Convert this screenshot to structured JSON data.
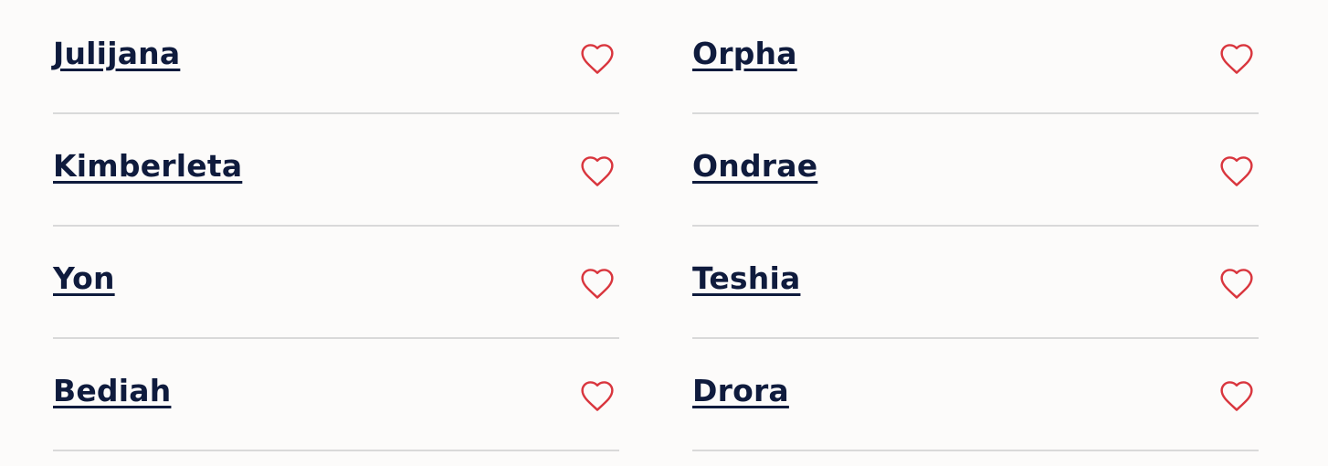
{
  "colors": {
    "background": "#fcfbfa",
    "name_text": "#0f1b3d",
    "heart_outline": "#d9363e",
    "divider": "#d9d9d9"
  },
  "icons": {
    "favorite": "heart-outline-icon"
  },
  "left_column": [
    {
      "name": "Julijana"
    },
    {
      "name": "Kimberleta"
    },
    {
      "name": "Yon"
    },
    {
      "name": "Bediah"
    }
  ],
  "right_column": [
    {
      "name": "Orpha"
    },
    {
      "name": "Ondrae"
    },
    {
      "name": "Teshia"
    },
    {
      "name": "Drora"
    }
  ]
}
